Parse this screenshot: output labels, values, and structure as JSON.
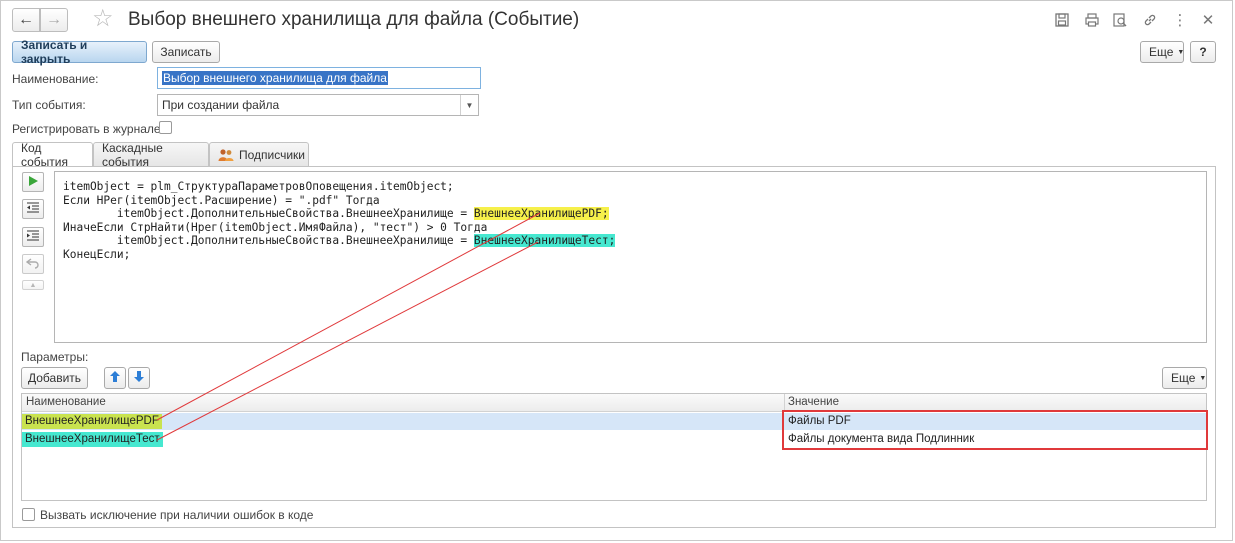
{
  "window": {
    "title": "Выбор внешнего хранилища для файла (Событие)"
  },
  "toolbar": {
    "save_close_label": "Записать и закрыть",
    "save_label": "Записать",
    "more_label": "Еще",
    "help_label": "?"
  },
  "form": {
    "name_label": "Наименование:",
    "name_value": "Выбор внешнего хранилища для файла",
    "event_type_label": "Тип события:",
    "event_type_value": "При создании файла",
    "log_label": "Регистрировать в журнале:"
  },
  "tabs": [
    {
      "label": "Код события"
    },
    {
      "label": "Каскадные события"
    },
    {
      "label": "Подписчики"
    }
  ],
  "code": {
    "line1": "itemObject = plm_СтруктураПараметровОповещения.itemObject;",
    "line2": "Если НРег(itemObject.Расширение) = \".pdf\" Тогда",
    "line3_prefix": "        itemObject.ДополнительныеСвойства.ВнешнееХранилище = ",
    "line3_hl": "ВнешнееХранилищеPDF;",
    "line4": "ИначеЕсли СтрНайти(Нрег(itemObject.ИмяФайла), \"тест\") > 0 Тогда",
    "line5_prefix": "        itemObject.ДополнительныеСвойства.ВнешнееХранилище = ",
    "line5_hl": "ВнешнееХранилищеТест;",
    "line6": "КонецЕсли;"
  },
  "params": {
    "title": "Параметры:",
    "add_label": "Добавить",
    "more_label": "Еще",
    "col_name": "Наименование",
    "col_value": "Значение",
    "rows": [
      {
        "name": "ВнешнееХранилищеPDF",
        "value": "Файлы PDF"
      },
      {
        "name": "ВнешнееХранилищеТест",
        "value": "Файлы документа вида Подлинник"
      }
    ]
  },
  "footer": {
    "raise_label": "Вызвать исключение при наличии ошибок в коде"
  },
  "colors": {
    "highlight_yellow": "#f6f04a",
    "highlight_cyan": "#46e8d0",
    "annotation_red": "#e0393b"
  }
}
